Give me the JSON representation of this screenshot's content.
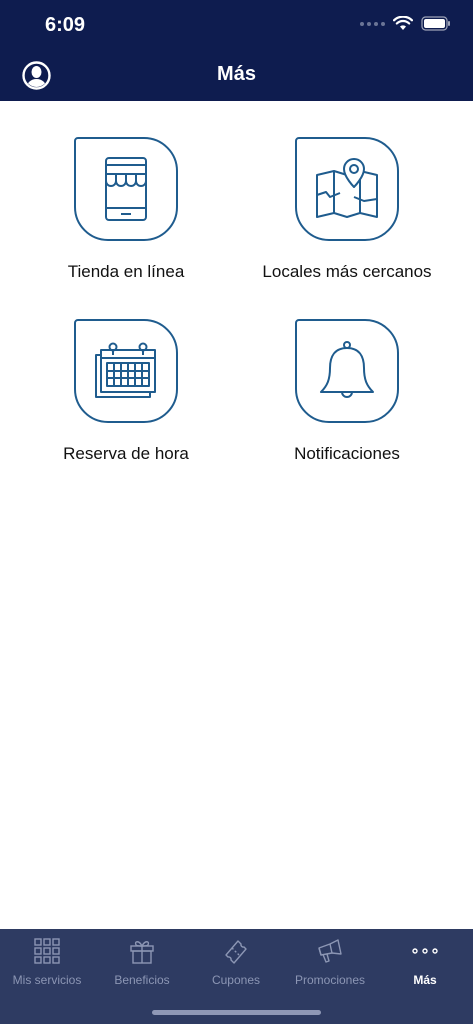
{
  "status": {
    "time": "6:09"
  },
  "header": {
    "title": "Más",
    "avatar_icon": "user-avatar-icon"
  },
  "colors": {
    "header_bg": "#0e1c4f",
    "accent": "#1f5c8e",
    "tabbar_bg": "#2e3b62"
  },
  "menu": {
    "items": [
      {
        "label": "Tienda en línea",
        "icon": "shop-icon"
      },
      {
        "label": "Locales más cercanos",
        "icon": "map-pin-icon"
      },
      {
        "label": "Reserva de hora",
        "icon": "calendar-icon"
      },
      {
        "label": "Notificaciones",
        "icon": "bell-icon"
      }
    ]
  },
  "tabbar": {
    "tabs": [
      {
        "label": "Mis servicios",
        "icon": "grid-icon",
        "active": false
      },
      {
        "label": "Beneficios",
        "icon": "gift-icon",
        "active": false
      },
      {
        "label": "Cupones",
        "icon": "ticket-icon",
        "active": false
      },
      {
        "label": "Promociones",
        "icon": "megaphone-icon",
        "active": false
      },
      {
        "label": "Más",
        "icon": "more-dots-icon",
        "active": true
      }
    ]
  }
}
